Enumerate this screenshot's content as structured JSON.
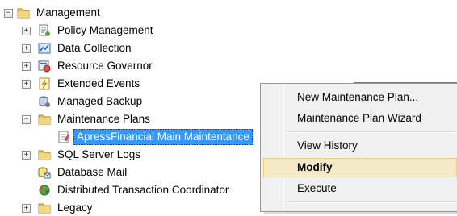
{
  "tree": {
    "items": [
      {
        "label": "Management",
        "icon": "folder-icon",
        "expander": "minus"
      },
      {
        "label": "Policy Management",
        "icon": "policy-icon",
        "expander": "plus"
      },
      {
        "label": "Data Collection",
        "icon": "data-collection-icon",
        "expander": "plus"
      },
      {
        "label": "Resource Governor",
        "icon": "resource-governor-icon",
        "expander": "plus"
      },
      {
        "label": "Extended Events",
        "icon": "extended-events-icon",
        "expander": "plus"
      },
      {
        "label": "Managed Backup",
        "icon": "managed-backup-icon",
        "expander": "none"
      },
      {
        "label": "Maintenance Plans",
        "icon": "folder-icon",
        "expander": "minus"
      },
      {
        "label": "ApressFinancial Main Maintentance",
        "icon": "maintenance-plan-icon",
        "expander": "none"
      },
      {
        "label": "SQL Server Logs",
        "icon": "folder-icon",
        "expander": "plus"
      },
      {
        "label": "Database Mail",
        "icon": "database-mail-icon",
        "expander": "none"
      },
      {
        "label": "Distributed Transaction Coordinator",
        "icon": "dtc-icon",
        "expander": "none"
      },
      {
        "label": "Legacy",
        "icon": "folder-icon",
        "expander": "plus"
      }
    ]
  },
  "context_menu": {
    "items": [
      {
        "label": "New Maintenance Plan..."
      },
      {
        "label": "Maintenance Plan Wizard"
      },
      {
        "label": "View History"
      },
      {
        "label": "Modify"
      },
      {
        "label": "Execute"
      }
    ]
  },
  "colors": {
    "selection": "#3399ff",
    "menu_highlight": "#f4eac4",
    "folder": "#e8c15a"
  }
}
